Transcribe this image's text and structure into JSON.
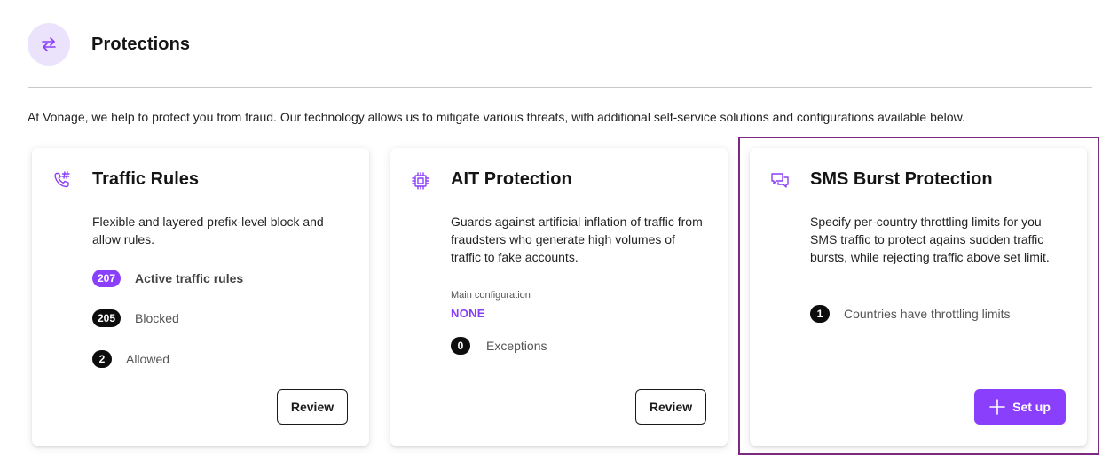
{
  "header": {
    "title": "Protections",
    "icon": "transfer-arrows-icon"
  },
  "intro": "At Vonage, we help to protect you from fraud. Our technology allows us to mitigate various threats, with additional self-service solutions and configurations available below.",
  "colors": {
    "accent": "#8a3ffc",
    "highlight_border": "#7b2a80",
    "icon_bg": "#ebe3fb",
    "badge_dark": "#0d0d0d"
  },
  "cards": [
    {
      "icon": "phone-hash-icon",
      "title": "Traffic Rules",
      "description": "Flexible and layered prefix-level block and allow rules.",
      "stats": [
        {
          "value": "207",
          "label": "Active traffic rules"
        },
        {
          "value": "205",
          "label": "Blocked"
        },
        {
          "value": "2",
          "label": "Allowed"
        }
      ],
      "button": "Review"
    },
    {
      "icon": "chip-icon",
      "title": "AIT Protection",
      "description": "Guards against artificial inflation of traffic from fraudsters who generate high volumes of traffic to fake accounts.",
      "config_label": "Main configuration",
      "config_value": "NONE",
      "stats": [
        {
          "value": "0",
          "label": "Exceptions"
        }
      ],
      "button": "Review"
    },
    {
      "icon": "chat-bubbles-icon",
      "title": "SMS Burst Protection",
      "description": "Specify per-country throttling limits for you SMS traffic to protect agains sudden traffic bursts, while rejecting traffic above set limit.",
      "stats": [
        {
          "value": "1",
          "label": "Countries have throttling limits"
        }
      ],
      "button": "Set up"
    }
  ]
}
